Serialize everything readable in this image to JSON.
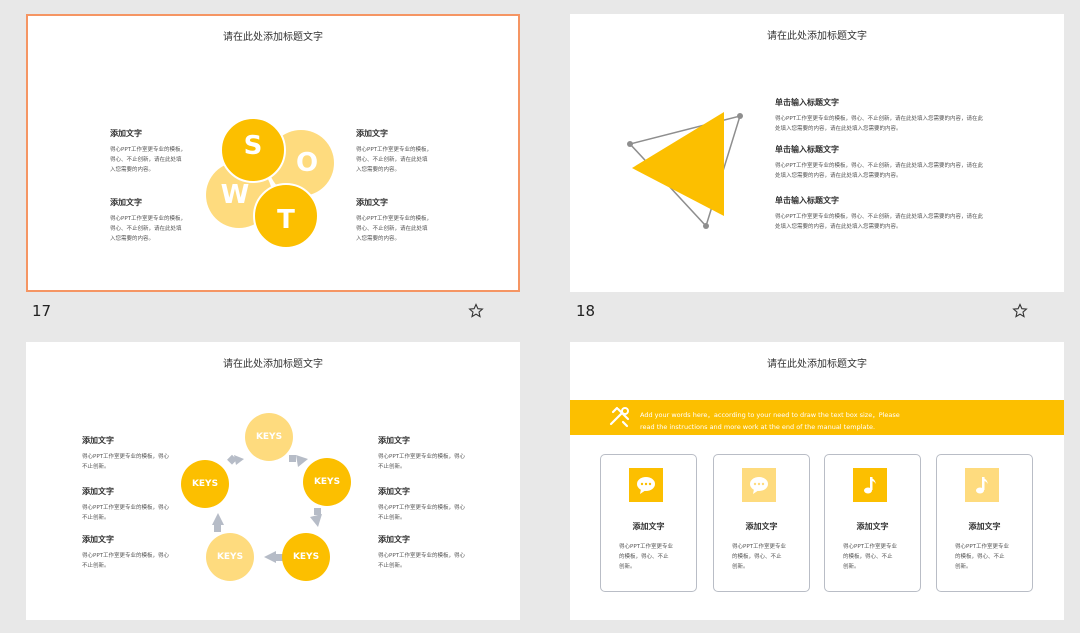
{
  "slides": [
    {
      "number": "17",
      "title": "请在此处添加标题文字",
      "blocks": [
        {
          "heading": "添加文字",
          "body": [
            "得心PPT工作室更专业的模板，",
            "得心、不止创新，请在此处填",
            "入您需要的内容。"
          ]
        },
        {
          "heading": "添加文字",
          "body": [
            "得心PPT工作室更专业的模板，",
            "得心、不止创新，请在此处填",
            "入您需要的内容。"
          ]
        },
        {
          "heading": "添加文字",
          "body": [
            "得心PPT工作室更专业的模板，",
            "得心、不止创新，请在此处填",
            "入您需要的内容。"
          ]
        },
        {
          "heading": "添加文字",
          "body": [
            "得心PPT工作室更专业的模板，",
            "得心、不止创新，请在此处填",
            "入您需要的内容。"
          ]
        }
      ],
      "letters": [
        "S",
        "O",
        "W",
        "T"
      ]
    },
    {
      "number": "18",
      "title": "请在此处添加标题文字",
      "blocks": [
        {
          "heading": "单击输入标题文字",
          "body": [
            "得心PPT工作室更专业的模板，得心、不止创新，请在此处填入您需要的内容，请在此",
            "处填入您需要的内容，请在此处填入您需要的内容。"
          ]
        },
        {
          "heading": "单击输入标题文字",
          "body": [
            "得心PPT工作室更专业的模板，得心、不止创新，请在此处填入您需要的内容，请在此",
            "处填入您需要的内容，请在此处填入您需要的内容。"
          ]
        },
        {
          "heading": "单击输入标题文字",
          "body": [
            "得心PPT工作室更专业的模板，得心、不止创新，请在此处填入您需要的内容，请在此",
            "处填入您需要的内容，请在此处填入您需要的内容。"
          ]
        }
      ]
    },
    {
      "title": "请在此处添加标题文字",
      "blocks": [
        {
          "heading": "添加文字",
          "body": [
            "得心PPT工作室更专业的模板，得心",
            "不止创新。"
          ]
        },
        {
          "heading": "添加文字",
          "body": [
            "得心PPT工作室更专业的模板，得心",
            "不止创新。"
          ]
        },
        {
          "heading": "添加文字",
          "body": [
            "得心PPT工作室更专业的模板，得心",
            "不止创新。"
          ]
        },
        {
          "heading": "添加文字",
          "body": [
            "得心PPT工作室更专业的模板，得心",
            "不止创新。"
          ]
        },
        {
          "heading": "添加文字",
          "body": [
            "得心PPT工作室更专业的模板，得心",
            "不止创新。"
          ]
        },
        {
          "heading": "添加文字",
          "body": [
            "得心PPT工作室更专业的模板，得心",
            "不止创新。"
          ]
        }
      ],
      "keys": [
        "KEYS",
        "KEYS",
        "KEYS",
        "KEYS",
        "KEYS"
      ]
    },
    {
      "title": "请在此处添加标题文字",
      "band_text": [
        "Add your words here，according to your need to draw the text box size，Please",
        "read the instructions and more work at the end of the manual template."
      ],
      "cards": [
        {
          "icon": "chat-bubble-icon",
          "heading": "添加文字",
          "body": [
            "得心PPT工作室更专业",
            "的模板，得心、不止",
            "创新。"
          ]
        },
        {
          "icon": "chat-bubble-icon",
          "heading": "添加文字",
          "body": [
            "得心PPT工作室更专业",
            "的模板，得心、不止",
            "创新。"
          ]
        },
        {
          "icon": "music-note-icon",
          "heading": "添加文字",
          "body": [
            "得心PPT工作室更专业",
            "的模板，得心、不止",
            "创新。"
          ]
        },
        {
          "icon": "music-note-icon",
          "heading": "添加文字",
          "body": [
            "得心PPT工作室更专业",
            "的模板，得心、不止",
            "创新。"
          ]
        }
      ]
    }
  ],
  "colors": {
    "accent": "#fcbf00",
    "accent_light": "#fedb7e",
    "selected_border": "#f59563",
    "background": "#e8e8e8"
  }
}
